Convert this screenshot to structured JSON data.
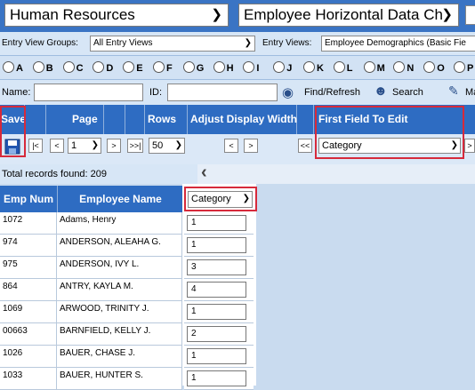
{
  "top_selects": {
    "module": "Human Resources",
    "view": "Employee Horizontal Data Ch"
  },
  "entry_view_groups": {
    "label": "Entry View Groups:",
    "value": "All Entry Views"
  },
  "entry_views": {
    "label": "Entry Views:",
    "value": "Employee Demographics (Basic Fie"
  },
  "letters": [
    "A",
    "B",
    "C",
    "D",
    "E",
    "F",
    "G",
    "H",
    "I",
    "J",
    "K",
    "L",
    "M",
    "N",
    "O",
    "P"
  ],
  "search": {
    "name_label": "Name:",
    "id_label": "ID:",
    "find_label": "Find/Refresh",
    "search_label": "Search",
    "extra_label": "Ma"
  },
  "toolbar": {
    "save": "Save",
    "page": "Page",
    "rows": "Rows",
    "adjust": "Adjust Display Width",
    "first_field": "First Field To Edit",
    "page_value": "1",
    "rows_value": "50",
    "first_field_value": "Category",
    "first_btn": "|<",
    "prev_btn": "<",
    "next_btn": ">",
    "last_btn": ">>|",
    "shrink_btn": "<",
    "grow_btn": ">",
    "back_btn": "<<",
    "fwd_btn": ">"
  },
  "total": "Total records found:  209",
  "collapse_icon": "‹",
  "grid": {
    "col_emp": "Emp Num",
    "col_name": "Employee Name",
    "category_select": "Category",
    "rows": [
      {
        "emp": "1072",
        "name": "Adams, Henry",
        "cat": "1"
      },
      {
        "emp": "974",
        "name": "ANDERSON, ALEAHA G.",
        "cat": "1"
      },
      {
        "emp": "975",
        "name": "ANDERSON, IVY L.",
        "cat": "3"
      },
      {
        "emp": "864",
        "name": "ANTRY, KAYLA M.",
        "cat": "4"
      },
      {
        "emp": "1069",
        "name": "ARWOOD, TRINITY J.",
        "cat": "1"
      },
      {
        "emp": "00663",
        "name": "BARNFIELD, KELLY J.",
        "cat": "2"
      },
      {
        "emp": "1026",
        "name": "BAUER, CHASE J.",
        "cat": "1"
      },
      {
        "emp": "1033",
        "name": "BAUER, HUNTER S.",
        "cat": "1"
      }
    ]
  },
  "colors": {
    "header_blue": "#2e6cc2",
    "highlight_red": "#d62a3b",
    "top_blue": "#3a74c4"
  }
}
